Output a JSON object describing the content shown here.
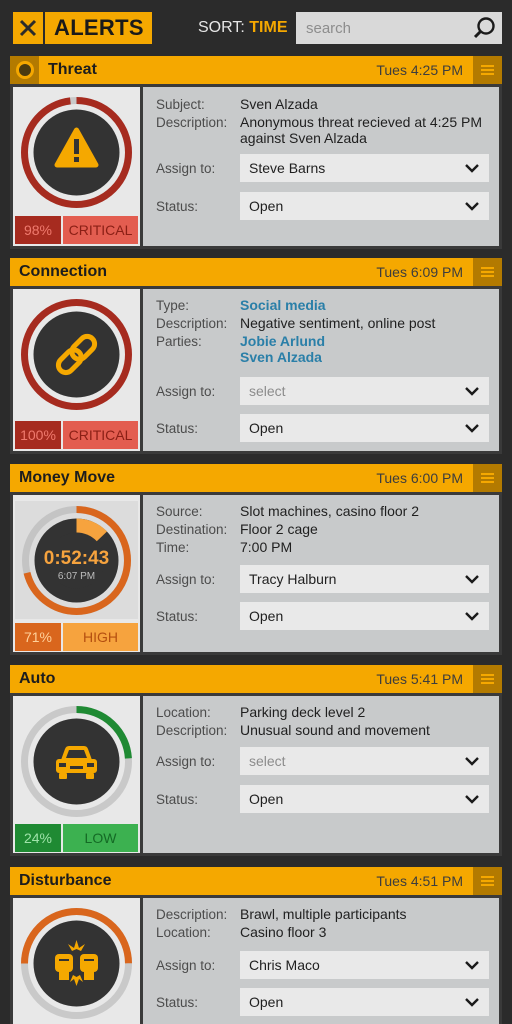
{
  "topbar": {
    "title": "ALERTS",
    "sort_label": "SORT:",
    "sort_value": "TIME",
    "search_placeholder": "search"
  },
  "colors": {
    "accent": "#f5a800",
    "critical": "#a62b1f",
    "critical_light": "#e35d50",
    "high": "#d9661d",
    "high_light": "#f6a33e",
    "low": "#1f8a33",
    "low_light": "#3cb150",
    "link": "#2a7fa8"
  },
  "labels": {
    "assign_to": "Assign to:",
    "status": "Status:"
  },
  "alerts": [
    {
      "title": "Threat",
      "time": "Tues 4:25 PM",
      "icon": "warning-icon",
      "percent": "98%",
      "level": "CRITICAL",
      "fields": [
        {
          "label": "Subject:",
          "value": "Sven Alzada"
        },
        {
          "label": "Description:",
          "value": "Anonymous threat recieved at 4:25 PM",
          "value2": "against Sven Alzada"
        }
      ],
      "assign_to": "Steve Barns",
      "status": "Open"
    },
    {
      "title": "Connection",
      "time": "Tues 6:09 PM",
      "icon": "link-icon",
      "percent": "100%",
      "level": "CRITICAL",
      "fields": [
        {
          "label": "Type:",
          "value": "Social media"
        },
        {
          "label": "Description:",
          "value": "Negative sentiment, online post"
        },
        {
          "label": "Parties:",
          "value": "Jobie Arlund",
          "value2": "Sven Alzada"
        }
      ],
      "assign_to": "select",
      "status": "Open"
    },
    {
      "title": "Money Move",
      "time": "Tues 6:00 PM",
      "icon": "timer-icon",
      "timer": "0:52:43",
      "timer_time": "6:07 PM",
      "percent": "71%",
      "level": "HIGH",
      "fields": [
        {
          "label": "Source:",
          "value": "Slot machines, casino floor 2"
        },
        {
          "label": "Destination:",
          "value": "Floor 2 cage"
        },
        {
          "label": "Time:",
          "value": "7:00 PM"
        }
      ],
      "assign_to": "Tracy Halburn",
      "status": "Open"
    },
    {
      "title": "Auto",
      "time": "Tues 5:41 PM",
      "icon": "car-icon",
      "percent": "24%",
      "level": "LOW",
      "fields": [
        {
          "label": "Location:",
          "value": "Parking deck level 2"
        },
        {
          "label": "Description:",
          "value": "Unusual sound and movement"
        }
      ],
      "assign_to": "select",
      "status": "Open"
    },
    {
      "title": "Disturbance",
      "time": "Tues 4:51 PM",
      "icon": "fight-icon",
      "fields": [
        {
          "label": "Description:",
          "value": "Brawl, multiple participants"
        },
        {
          "label": "Location:",
          "value": "Casino floor 3"
        }
      ],
      "assign_to": "Chris Maco",
      "status": "Open"
    }
  ]
}
